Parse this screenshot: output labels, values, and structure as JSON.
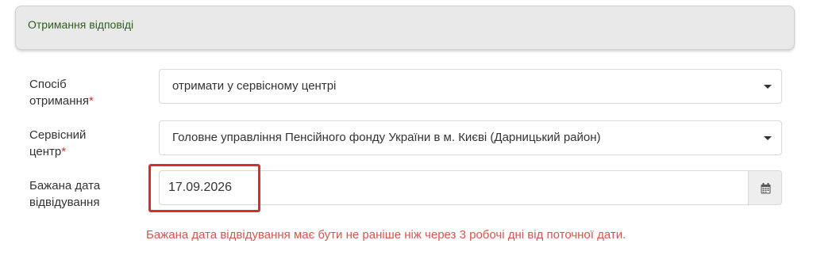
{
  "panel": {
    "title": "Отримання відповіді"
  },
  "form": {
    "method": {
      "label_line1": "Спосіб",
      "label_line2": "отримання",
      "required_mark": "*",
      "value": "отримати у сервісному центрі"
    },
    "service_center": {
      "label_line1": "Сервісний",
      "label_line2": "центр",
      "required_mark": "*",
      "value": "Головне управління Пенсійного фонду України в м. Києві (Дарницький район)"
    },
    "visit_date": {
      "label_line1": "Бажана дата",
      "label_line2": "відвідування",
      "value": "17.09.2026",
      "icon": "calendar-icon"
    },
    "error_message": "Бажана дата відвідування має бути не раніше ніж через 3 робочі дні від поточної дати."
  },
  "colors": {
    "panel_title": "#2f5d1e",
    "required": "#c0392b",
    "error": "#d9534f",
    "highlight": "#d32f2f"
  }
}
